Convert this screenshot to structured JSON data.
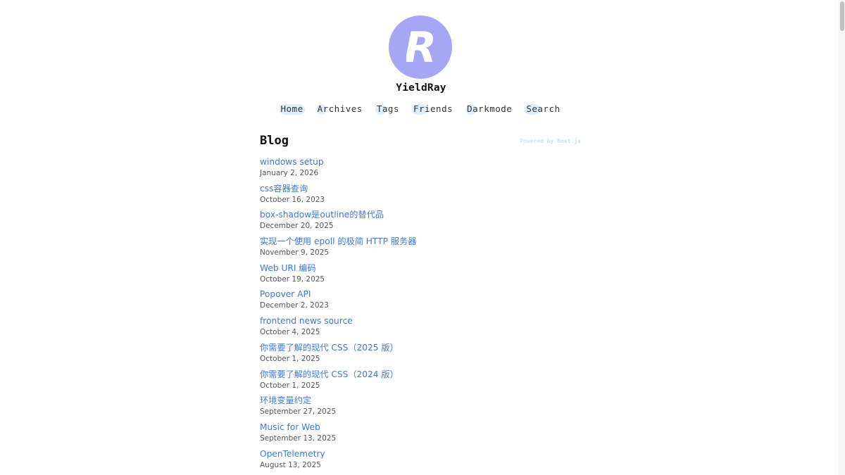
{
  "site": {
    "avatar_letter": "R",
    "avatar_color": "#a5a6f6",
    "title": "YieldRay"
  },
  "nav": [
    {
      "label": "Home",
      "active": true
    },
    {
      "label": "Archives"
    },
    {
      "label": "Tags"
    },
    {
      "label": "Friends"
    },
    {
      "label": "Darkmode"
    },
    {
      "label": "Search"
    }
  ],
  "main": {
    "heading": "Blog",
    "powered_prefix": "Powered by ",
    "powered_name": "Next.js",
    "posts": [
      {
        "title": "windows setup",
        "date": "January 2, 2026"
      },
      {
        "title": "css容器查询",
        "date": "October 16, 2023"
      },
      {
        "title": "box-shadow是outline的替代品",
        "date": "December 20, 2025"
      },
      {
        "title": "实现一个使用 epoll 的极简 HTTP 服务器",
        "date": "November 9, 2025"
      },
      {
        "title": "Web URI 编码",
        "date": "October 19, 2025"
      },
      {
        "title": "Popover API",
        "date": "December 2, 2023"
      },
      {
        "title": "frontend news source",
        "date": "October 4, 2025"
      },
      {
        "title": "你需要了解的现代 CSS（2025 版）",
        "date": "October 1, 2025"
      },
      {
        "title": "你需要了解的现代 CSS（2024 版）",
        "date": "October 1, 2025"
      },
      {
        "title": "环境变量约定",
        "date": "September 27, 2025"
      },
      {
        "title": "Music for Web",
        "date": "September 13, 2025"
      },
      {
        "title": "OpenTelemetry",
        "date": "August 13, 2025"
      }
    ]
  },
  "colors": {
    "link": "#3a7bd5",
    "nav_highlight": "#dfeefc"
  }
}
